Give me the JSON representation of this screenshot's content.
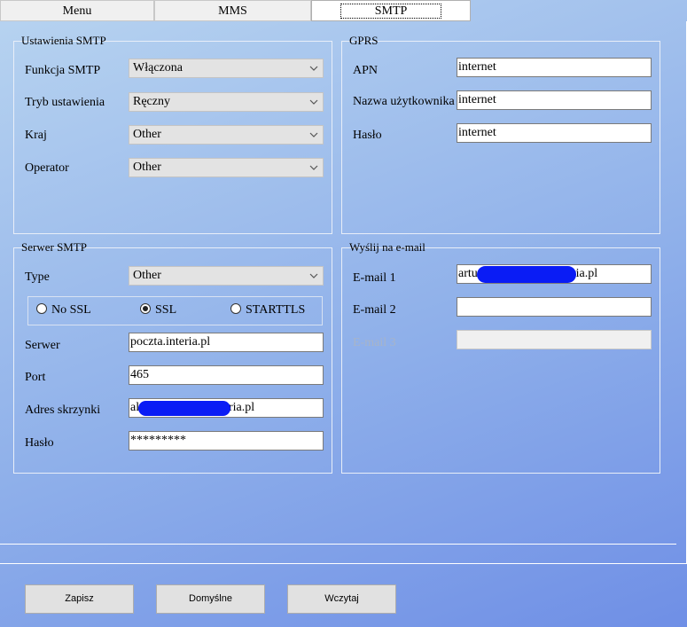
{
  "tabs": {
    "menu": "Menu",
    "mms": "MMS",
    "smtp": "SMTP"
  },
  "smtp_settings": {
    "legend": "Ustawienia SMTP",
    "function_label": "Funkcja SMTP",
    "function_value": "Włączona",
    "mode_label": "Tryb ustawienia",
    "mode_value": "Ręczny",
    "country_label": "Kraj",
    "country_value": "Other",
    "operator_label": "Operator",
    "operator_value": "Other"
  },
  "gprs": {
    "legend": "GPRS",
    "apn_label": "APN",
    "apn_value": "internet",
    "user_label": "Nazwa użytkownika",
    "user_value": "internet",
    "password_label": "Hasło",
    "password_value": "internet"
  },
  "smtp_server": {
    "legend": "Serwer SMTP",
    "type_label": "Type",
    "type_value": "Other",
    "radio_nossl": "No SSL",
    "radio_ssl": "SSL",
    "radio_starttls": "STARTTLS",
    "selected_security": "SSL",
    "server_label": "Serwer",
    "server_value": "poczta.interia.pl",
    "port_label": "Port",
    "port_value": "465",
    "mailbox_label": "Adres skrzynki",
    "mailbox_prefix": "al",
    "mailbox_suffix": "ria.pl",
    "password_label": "Hasło",
    "password_value": "*********"
  },
  "send_email": {
    "legend": "Wyślij na e-mail",
    "email1_label": "E-mail 1",
    "email1_prefix": "artu",
    "email1_suffix": "ria.pl",
    "email2_label": "E-mail 2",
    "email2_value": "",
    "email3_label": "E-mail 3",
    "email3_value": ""
  },
  "buttons": {
    "save": "Zapisz",
    "defaults": "Domyślne",
    "load": "Wczytaj"
  },
  "colors": {
    "redaction": "#0a1cf5",
    "background_start": "#b8d4f0",
    "background_end": "#6f8fe6"
  }
}
